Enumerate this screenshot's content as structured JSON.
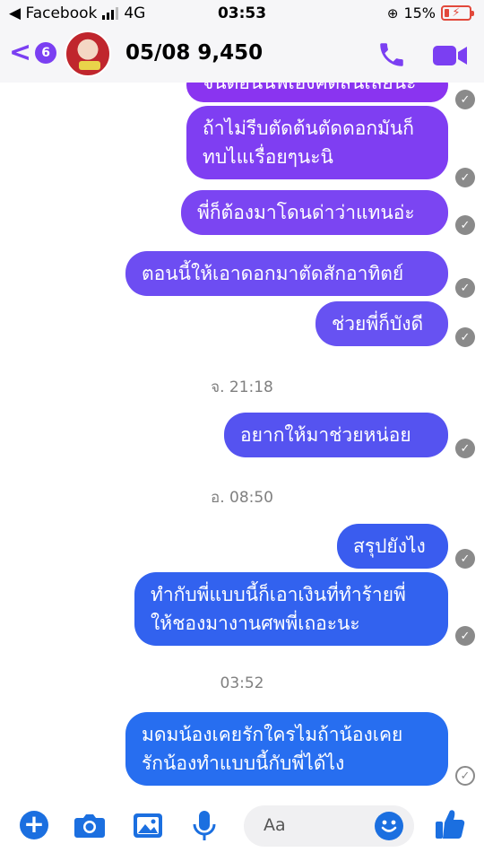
{
  "status_bar": {
    "back_app": "◀ Facebook",
    "network": "4G",
    "time": "03:53",
    "battery": "15%"
  },
  "header": {
    "title": "05/08 9,450",
    "unread_badge": "6"
  },
  "messages": [
    {
      "text": "จนตอนนี้พี่เองคิดสิ้นเลยนะ",
      "color": "#8a34f0"
    },
    {
      "text": "ถ้าไม่รีบตัดต้นตัดดอกมันก็\nทบไแเรื่อยๆนะนิ",
      "color": "#7f3ef2"
    },
    {
      "text": "พี่ก็ต้องมาโดนด่าว่าแทนอ่ะ",
      "color": "#7b45f2"
    },
    {
      "text": "ตอนนี้ให้เอาดอกมาตัดสักอาทิตย์",
      "color": "#6d4df2"
    },
    {
      "text": "ช่วยพี่ก็บังดี",
      "color": "#6752f2"
    },
    {
      "text": "อยากให้มาช่วยหน่อย",
      "color": "#5553f0"
    },
    {
      "text": "สรุปยังไง",
      "color": "#3a5cef"
    },
    {
      "text": "ทำกับพี่แบบนี้ก็เอาเงินที่ทำร้ายพี่\nให้ชองมางานศพพี่เถอะนะ",
      "color": "#3262ef"
    },
    {
      "text": "มดมน้องเคยรักใครไมถ้าน้องเคย\nรักน้องทำแบบนี้กับพี่ได้ไง",
      "color": "#276ef0"
    }
  ],
  "timestamps": [
    "จ. 21:18",
    "อ. 08:50",
    "03:52"
  ],
  "read_check": "✓",
  "composer": {
    "placeholder": "Aa"
  },
  "icons": [
    "back-chevron-icon",
    "phone-icon",
    "video-camera-icon",
    "plus-icon",
    "camera-icon",
    "image-icon",
    "microphone-icon",
    "emoji-icon",
    "thumbs-up-icon"
  ]
}
